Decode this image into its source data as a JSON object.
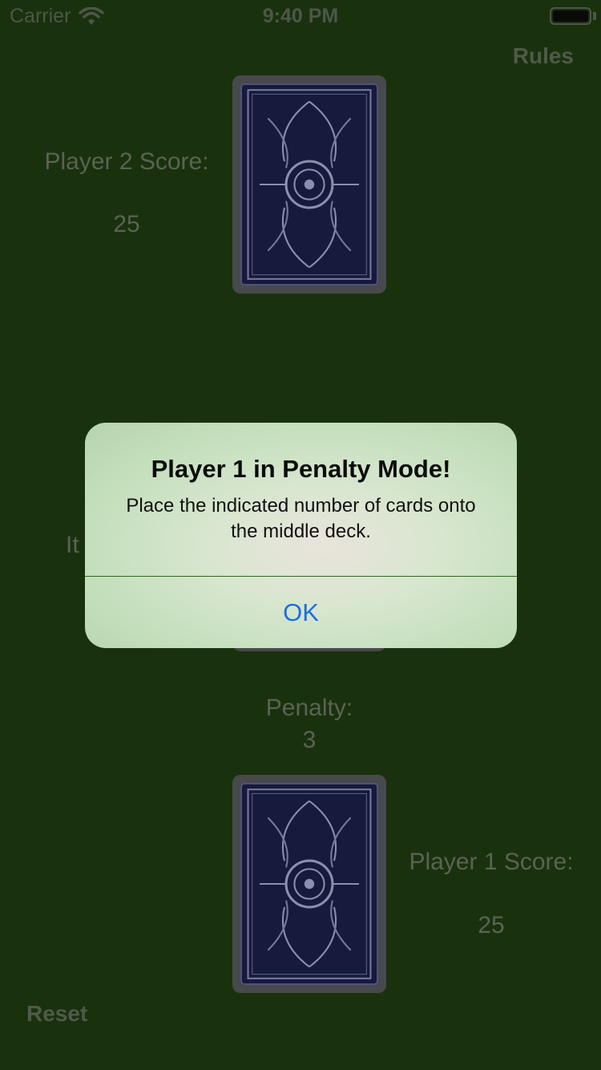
{
  "status_bar": {
    "carrier": "Carrier",
    "time": "9:40 PM"
  },
  "header": {
    "rules_label": "Rules"
  },
  "player2": {
    "score_label": "Player 2 Score:",
    "score_value": "25"
  },
  "middle": {
    "partial_label": "It",
    "penalty_label": "Penalty:",
    "penalty_value": "3"
  },
  "player1": {
    "score_label": "Player 1 Score:",
    "score_value": "25"
  },
  "footer": {
    "reset_label": "Reset"
  },
  "alert": {
    "title": "Player 1 in Penalty Mode!",
    "message": "Place the indicated number of cards onto the middle deck.",
    "ok_label": "OK"
  },
  "colors": {
    "felt": "#1f3a10",
    "card_back": "#1b1f47",
    "accent": "#1b6fe0"
  }
}
